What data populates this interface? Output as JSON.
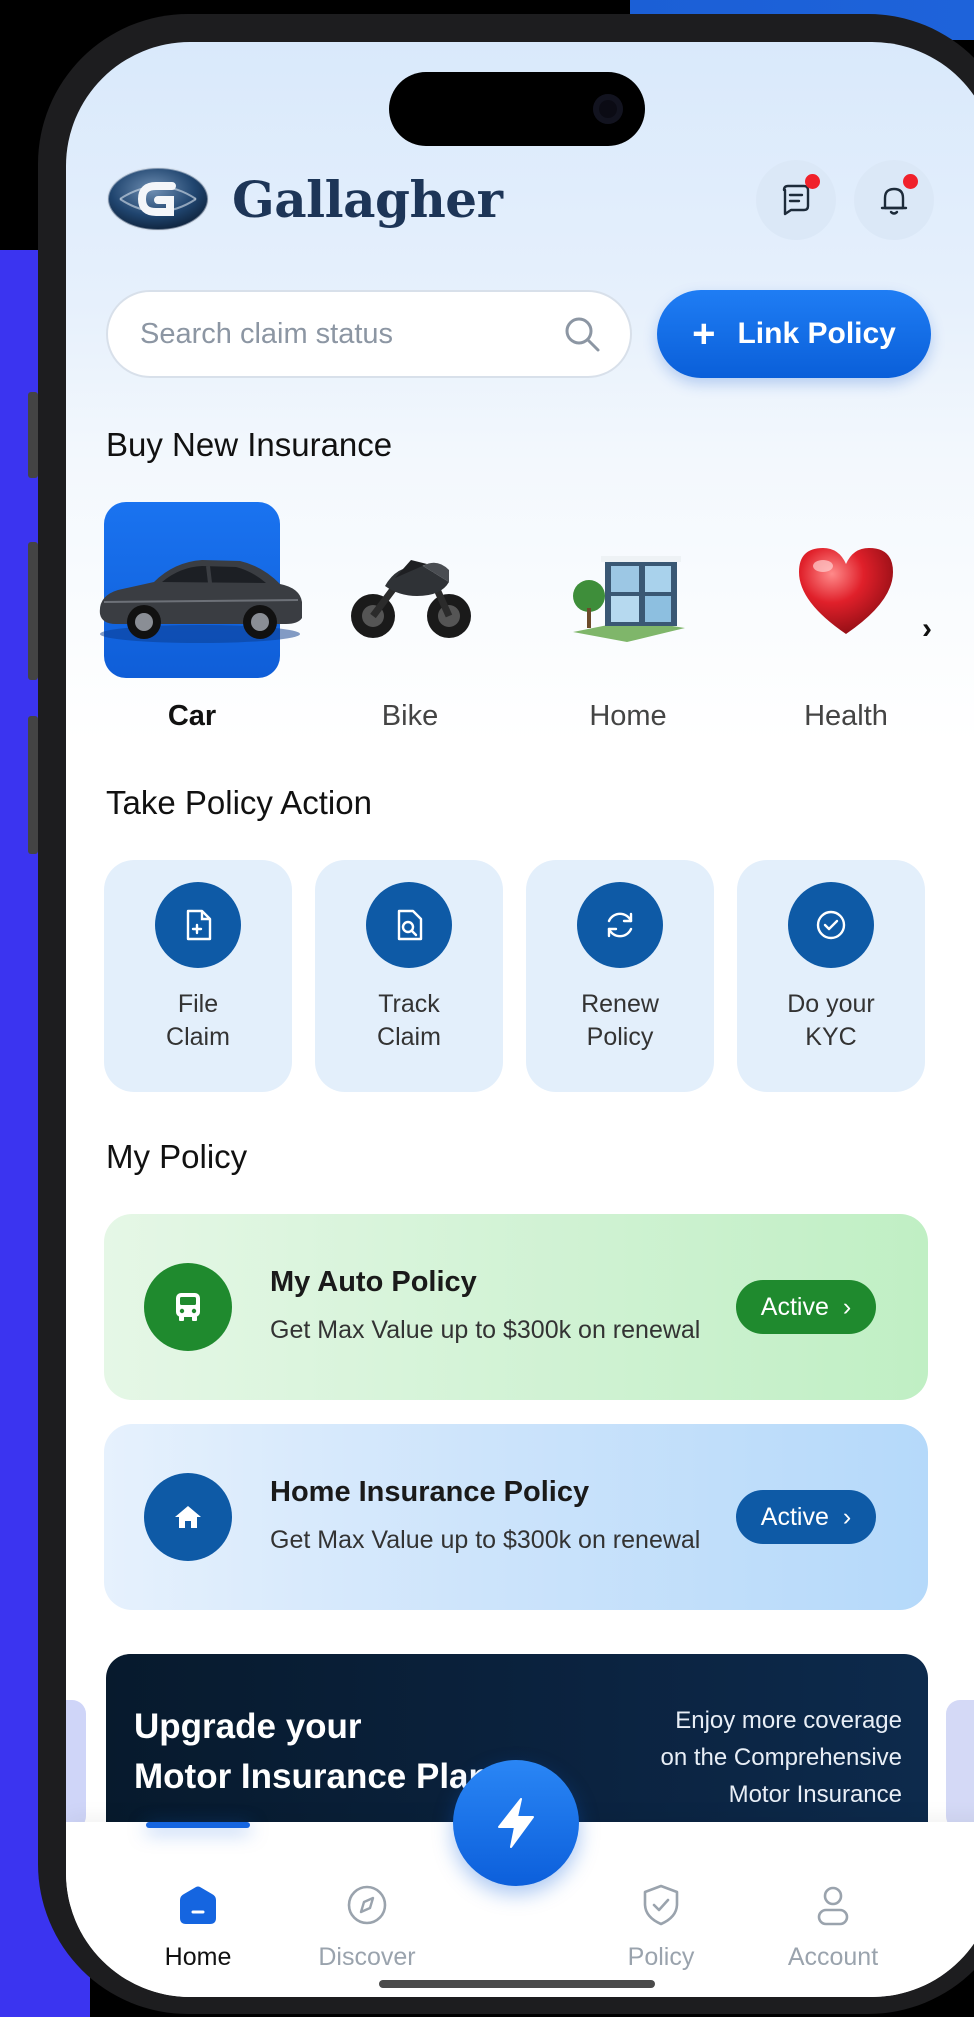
{
  "brand": {
    "name": "Gallagher"
  },
  "header": {
    "messages_icon": "message-icon",
    "notifications_icon": "bell-icon",
    "badge_color": "#f0212b"
  },
  "search": {
    "placeholder": "Search claim status",
    "icon": "search-icon"
  },
  "link_policy": {
    "label": "Link Policy",
    "icon": "plus-icon"
  },
  "buy_new_insurance": {
    "title": "Buy New Insurance",
    "items": [
      {
        "label": "Car",
        "icon": "car-image",
        "selected": true
      },
      {
        "label": "Bike",
        "icon": "motorbike-image",
        "selected": false
      },
      {
        "label": "Home",
        "icon": "house-image",
        "selected": false
      },
      {
        "label": "Health",
        "icon": "heart-image",
        "selected": false
      }
    ],
    "next_icon": "chevron-right-icon"
  },
  "policy_actions": {
    "title": "Take Policy Action",
    "items": [
      {
        "line1": "File",
        "line2": "Claim",
        "icon": "file-add-icon"
      },
      {
        "line1": "Track",
        "line2": "Claim",
        "icon": "file-search-icon"
      },
      {
        "line1": "Renew",
        "line2": "Policy",
        "icon": "refresh-icon"
      },
      {
        "line1": "Do your",
        "line2": "KYC",
        "icon": "check-circle-icon"
      }
    ]
  },
  "my_policy": {
    "title": "My Policy",
    "policies": [
      {
        "title": "My Auto Policy",
        "subtitle": "Get Max Value up to $300k on renewal",
        "status": "Active",
        "icon": "bus-icon",
        "color": "#1f8a2e"
      },
      {
        "title": "Home Insurance Policy",
        "subtitle": "Get Max Value up to $300k on renewal",
        "status": "Active",
        "icon": "home-icon",
        "color": "#0e5aa6"
      }
    ]
  },
  "banner": {
    "title_line1": "Upgrade your",
    "title_line2": "Motor Insurance Plan",
    "desc_line1": "Enjoy more coverage",
    "desc_line2": "on the Comprehensive",
    "desc_line3": "Motor Insurance"
  },
  "tabbar": {
    "tabs": [
      {
        "label": "Home",
        "icon": "home-icon",
        "active": true
      },
      {
        "label": "Discover",
        "icon": "compass-icon",
        "active": false
      },
      {
        "label": "Policy",
        "icon": "shield-check-icon",
        "active": false
      },
      {
        "label": "Account",
        "icon": "user-icon",
        "active": false
      }
    ],
    "center_action_icon": "lightning-icon"
  },
  "colors": {
    "accent": "#1565e0",
    "navy": "#0e5aa6",
    "green": "#1f8a2e"
  }
}
